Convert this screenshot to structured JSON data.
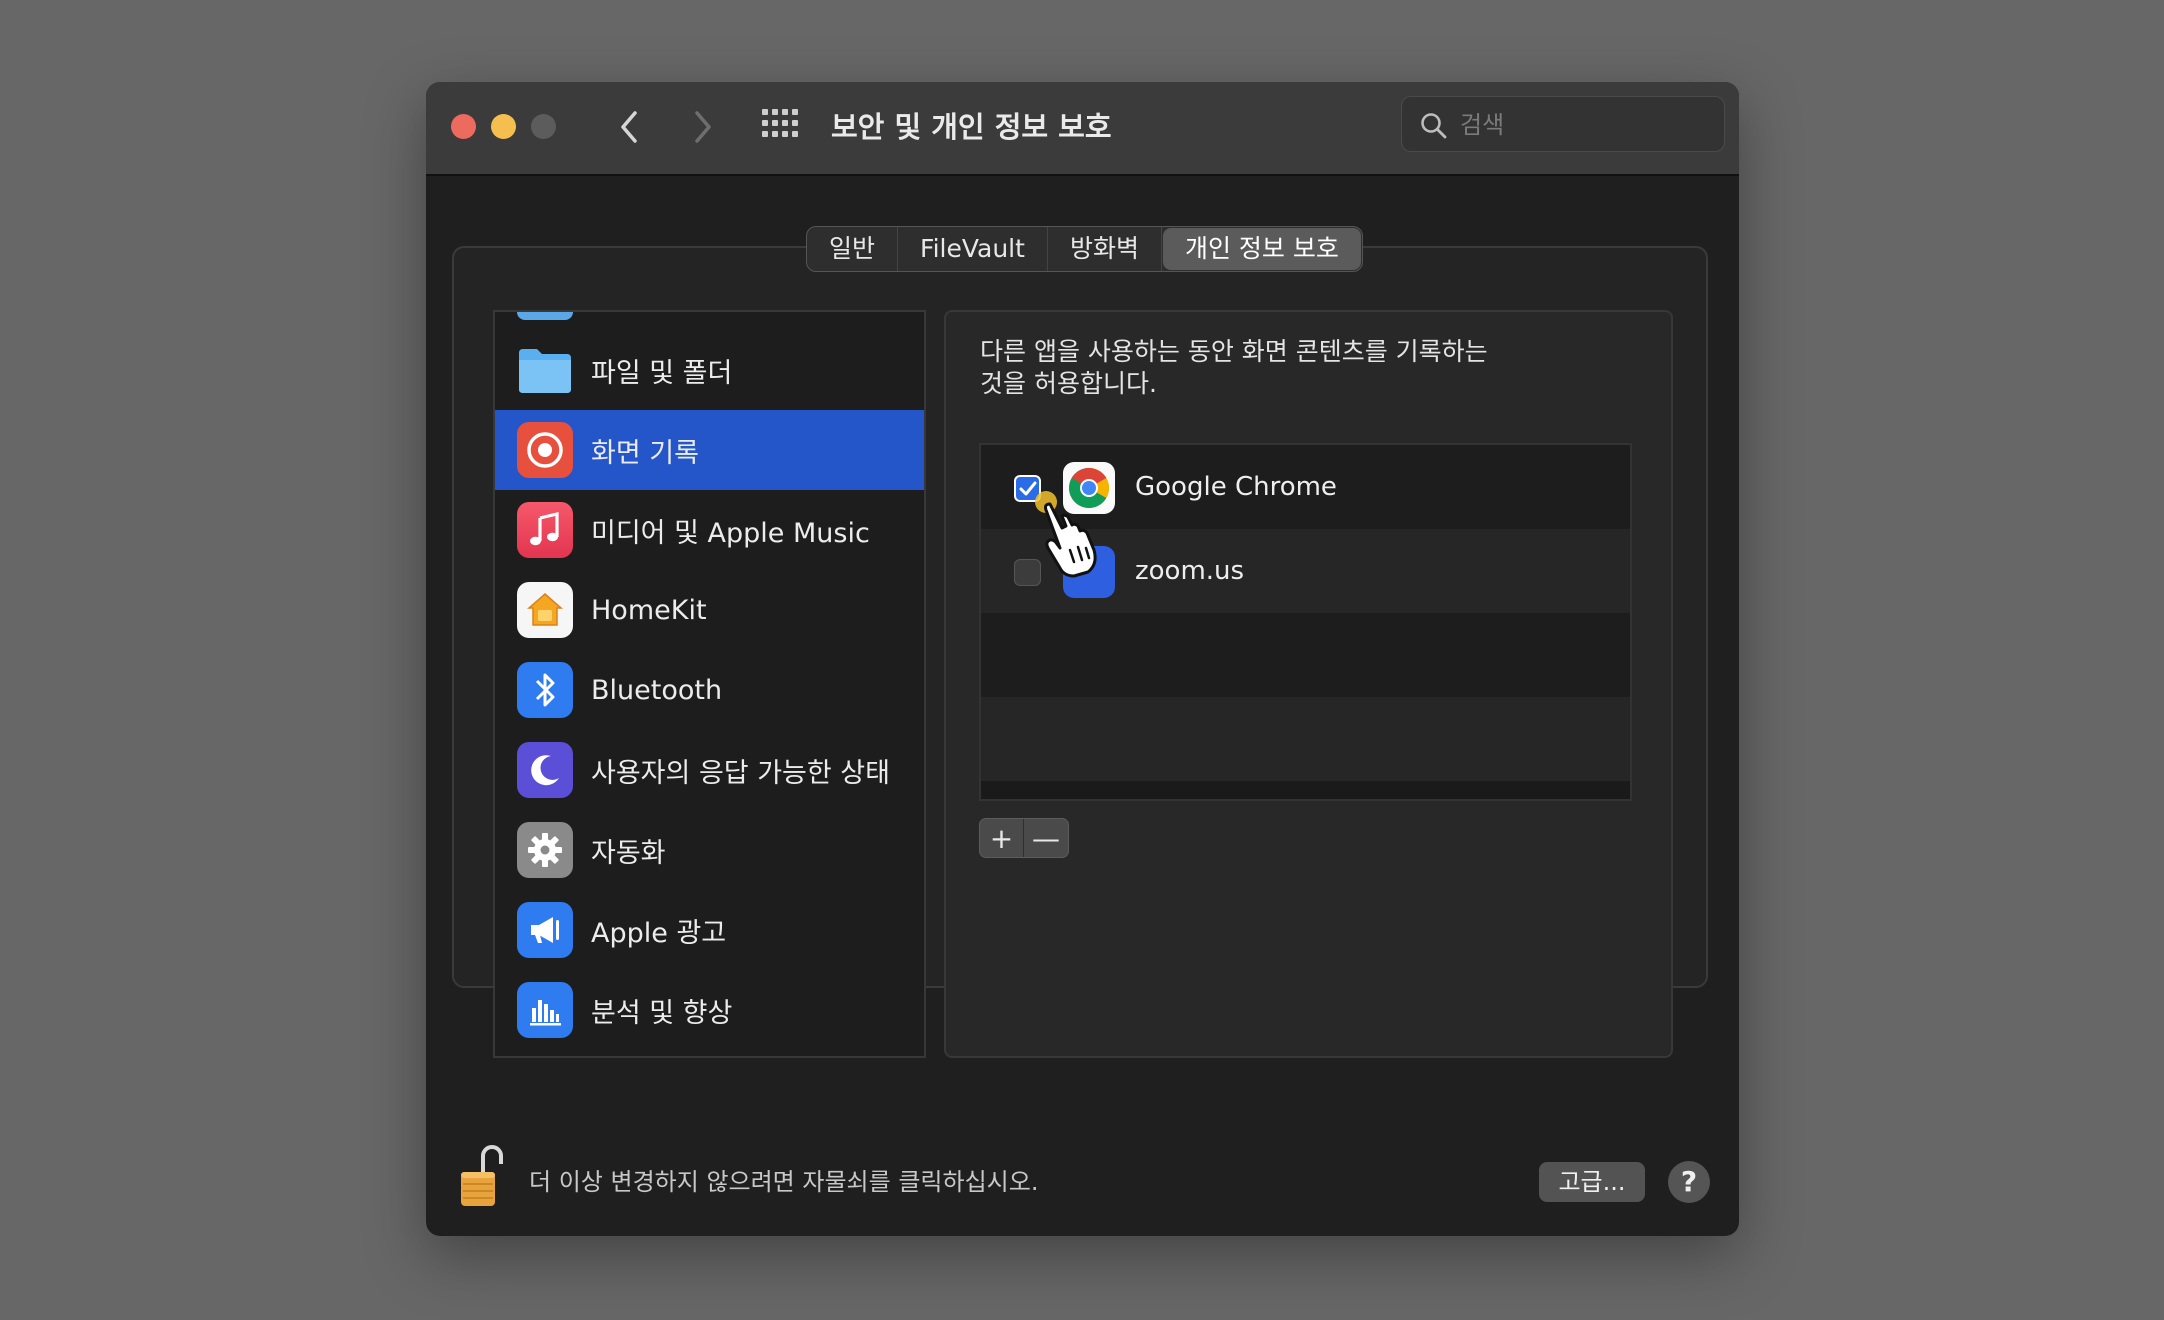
{
  "window": {
    "title": "보안 및 개인 정보 보호",
    "search_placeholder": "검색"
  },
  "tabs": [
    {
      "label": "일반",
      "active": false
    },
    {
      "label": "FileVault",
      "active": false
    },
    {
      "label": "방화벽",
      "active": false
    },
    {
      "label": "개인 정보 보호",
      "active": true
    }
  ],
  "sidebar": {
    "items": [
      {
        "label": "파일 및 폴더",
        "icon": "folder-icon",
        "selected": false
      },
      {
        "label": "화면 기록",
        "icon": "screen-record-icon",
        "selected": true
      },
      {
        "label": "미디어 및 Apple Music",
        "icon": "music-icon",
        "selected": false
      },
      {
        "label": "HomeKit",
        "icon": "home-icon",
        "selected": false
      },
      {
        "label": "Bluetooth",
        "icon": "bluetooth-icon",
        "selected": false
      },
      {
        "label": "사용자의 응답 가능한 상태",
        "icon": "moon-icon",
        "selected": false
      },
      {
        "label": "자동화",
        "icon": "gear-icon",
        "selected": false
      },
      {
        "label": "Apple 광고",
        "icon": "megaphone-icon",
        "selected": false
      },
      {
        "label": "분석 및 향상",
        "icon": "analytics-icon",
        "selected": false
      }
    ]
  },
  "detail": {
    "description_line1": "다른 앱을 사용하는 동안 화면 콘텐츠를 기록하는",
    "description_line2": "것을 허용합니다.",
    "apps": [
      {
        "name": "Google Chrome",
        "checked": true,
        "icon": "chrome-icon"
      },
      {
        "name": "zoom.us",
        "checked": false,
        "icon": "zoom-icon"
      }
    ],
    "add_label": "+",
    "remove_label": "—"
  },
  "footer": {
    "lock_text": "더 이상 변경하지 않으려면 자물쇠를 클릭하십시오.",
    "advanced_label": "고급...",
    "help_label": "?"
  },
  "colors": {
    "selection": "#2456c9",
    "window_bg": "#1f1f1f",
    "titlebar_bg": "#3b3b3b"
  }
}
